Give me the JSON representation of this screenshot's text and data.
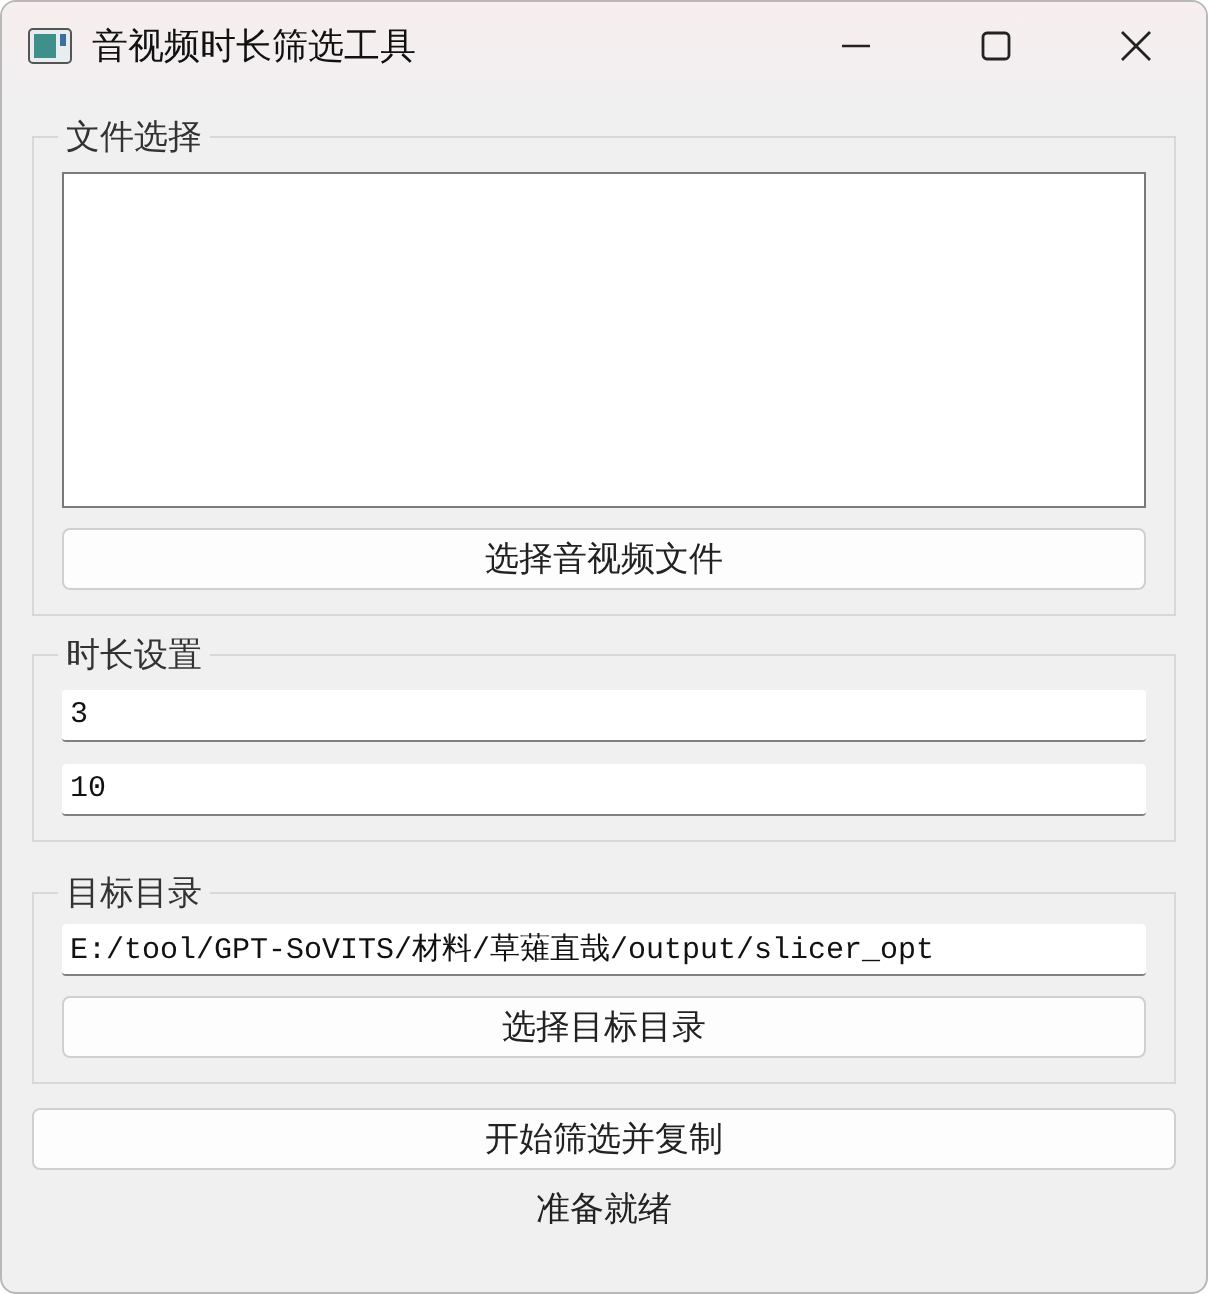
{
  "window": {
    "title": "音视频时长筛选工具"
  },
  "file_group": {
    "title": "文件选择",
    "button": "选择音视频文件"
  },
  "duration_group": {
    "title": "时长设置",
    "fields": [
      {
        "value": "3"
      },
      {
        "value": "10"
      }
    ]
  },
  "target_group": {
    "title": "目标目录",
    "path": "E:/tool/GPT-SoVITS/材料/草薙直哉/output/slicer_opt",
    "button": "选择目标目录"
  },
  "start_button": "开始筛选并复制",
  "status": "准备就绪"
}
